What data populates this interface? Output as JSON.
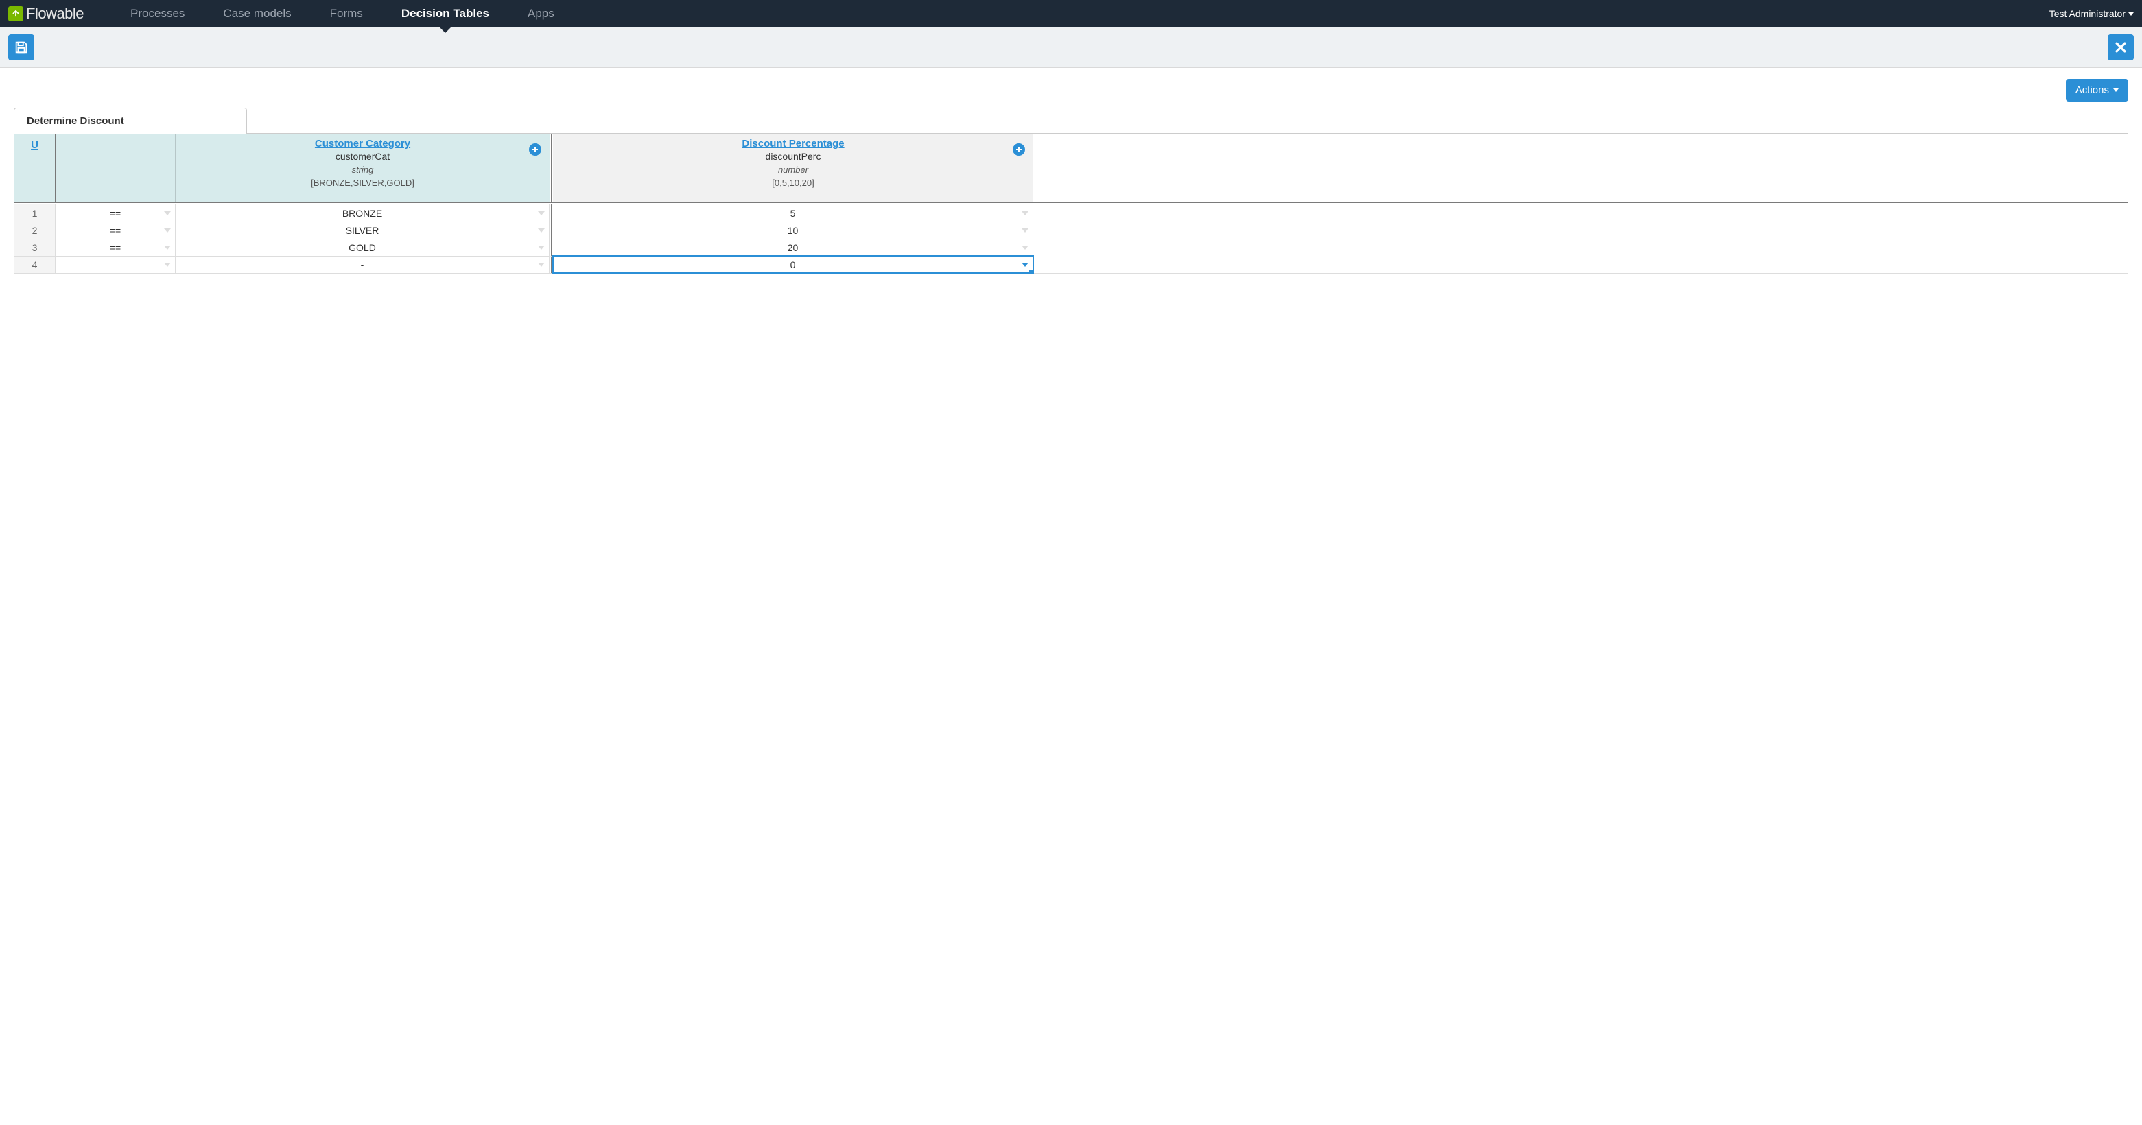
{
  "nav": {
    "brand": "Flowable",
    "items": [
      {
        "label": "Processes",
        "active": false
      },
      {
        "label": "Case models",
        "active": false
      },
      {
        "label": "Forms",
        "active": false
      },
      {
        "label": "Decision Tables",
        "active": true
      },
      {
        "label": "Apps",
        "active": false
      }
    ],
    "user": "Test Administrator"
  },
  "actions_label": "Actions",
  "tab_title": "Determine Discount",
  "hit_policy": "U",
  "input_column": {
    "title": "Customer Category",
    "variable": "customerCat",
    "type": "string",
    "values": "[BRONZE,SILVER,GOLD]"
  },
  "output_column": {
    "title": "Discount Percentage",
    "variable": "discountPerc",
    "type": "number",
    "values": "[0,5,10,20]"
  },
  "rows": [
    {
      "num": "1",
      "op": "==",
      "input": "BRONZE",
      "output": "5"
    },
    {
      "num": "2",
      "op": "==",
      "input": "SILVER",
      "output": "10"
    },
    {
      "num": "3",
      "op": "==",
      "input": "GOLD",
      "output": "20"
    },
    {
      "num": "4",
      "op": "",
      "input": "-",
      "output": "0",
      "selected_output": true
    }
  ],
  "colors": {
    "accent": "#2b8fd6",
    "nav_bg": "#1e2a38",
    "brand_green": "#7ab800",
    "input_bg": "#d7ebec",
    "output_bg": "#f1f1f1"
  }
}
